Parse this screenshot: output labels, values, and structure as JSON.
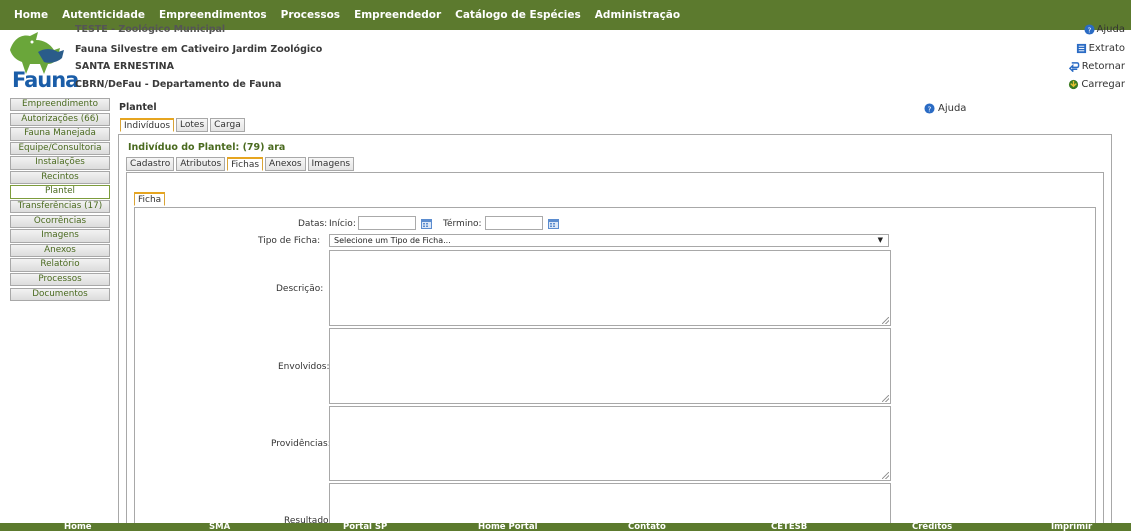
{
  "nav": {
    "items": [
      "Home",
      "Autenticidade",
      "Empreendimentos",
      "Processos",
      "Empreendedor",
      "Catálogo de Espécies",
      "Administração"
    ]
  },
  "header": {
    "cut_line": "TESTE - Zoológico Municipal",
    "line1": "Fauna Silvestre em Cativeiro Jardim Zoológico",
    "line2": "SANTA ERNESTINA",
    "line3": "CBRN/DeFau - Departamento de Fauna",
    "logo_text": "Fauna",
    "right_links": [
      "Ajuda",
      "Extrato",
      "Retornar",
      "Carregar"
    ]
  },
  "sidebar": {
    "items": [
      "Empreendimento",
      "Autorizações (66)",
      "Fauna Manejada",
      "Equipe/Consultoria",
      "Instalações",
      "Recintos",
      "Plantel",
      "Transferências (17)",
      "Ocorrências",
      "Imagens",
      "Anexos",
      "Relatório",
      "Processos",
      "Documentos"
    ],
    "active": "Plantel"
  },
  "main": {
    "title": "Plantel",
    "help": "Ajuda",
    "tabs": [
      "Indivíduos",
      "Lotes",
      "Carga"
    ],
    "subtitle": "Indivíduo do Plantel: (79) ara",
    "subtabs": [
      "Cadastro",
      "Atributos",
      "Fichas",
      "Anexos",
      "Imagens"
    ],
    "inner_tab": "Ficha"
  },
  "form": {
    "datas_label": "Datas:",
    "inicio_label": "Início:",
    "termino_label": "Término:",
    "inicio_value": "",
    "termino_value": "",
    "tipo_label": "Tipo de Ficha:",
    "tipo_selected": "Selecione um Tipo de Ficha...",
    "descricao_label": "Descrição:",
    "envolvidos_label": "Envolvidos:",
    "providencias_label": "Providências:",
    "resultado_label": "Resultado:"
  },
  "footer": {
    "items": [
      "Home",
      "SMA",
      "Portal SP",
      "Home Portal",
      "Contato",
      "CETESB",
      "Créditos",
      "Imprimir"
    ]
  },
  "colors": {
    "nav_green": "#5c7a2e",
    "link_green": "#4a6a1f",
    "tab_accent": "#e6a520",
    "logo_blue": "#1a5da8"
  }
}
